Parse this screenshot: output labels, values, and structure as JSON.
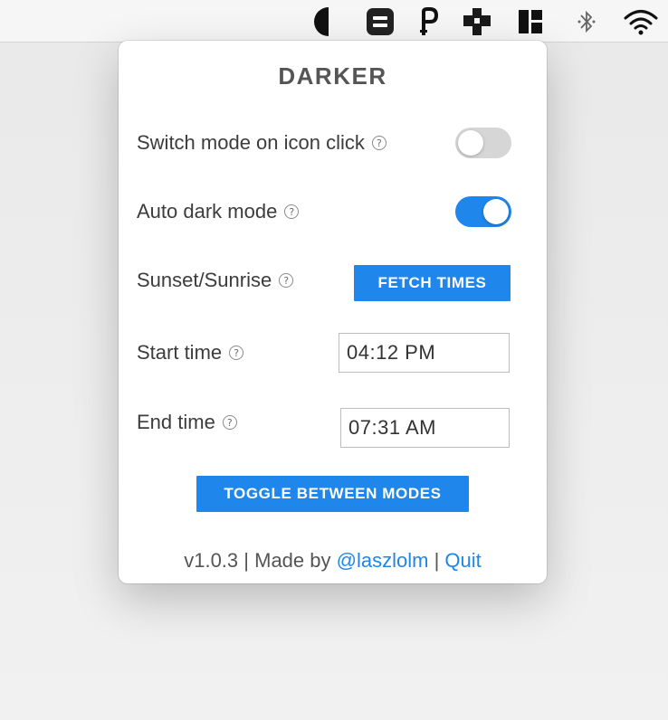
{
  "menubar": {
    "icons": [
      "half-moon-icon",
      "menu-app-icon",
      "p-app-icon",
      "puzzle-app-icon",
      "grid-app-icon",
      "bluetooth-icon",
      "wifi-icon"
    ]
  },
  "popover": {
    "title": "DARKER",
    "settings": {
      "switch_mode_label": "Switch mode on icon click",
      "switch_mode_enabled": false,
      "auto_dark_label": "Auto dark mode",
      "auto_dark_enabled": true,
      "sunset_label": "Sunset/Sunrise",
      "fetch_times_label": "FETCH TIMES",
      "start_time_label": "Start time",
      "start_time_value": "04:12 PM",
      "end_time_label": "End time",
      "end_time_value": "07:31 AM",
      "help_glyph": "?"
    },
    "toggle_button_label": "TOGGLE BETWEEN MODES",
    "footer": {
      "version": "v1.0.3",
      "separator": "|",
      "made_by": "Made by",
      "author_link": "@laszlolm",
      "quit_link": "Quit"
    }
  },
  "colors": {
    "accent": "#1f86eb",
    "toggle_off": "#d6d6d6",
    "text": "#3c3c3c",
    "title": "#555555"
  }
}
